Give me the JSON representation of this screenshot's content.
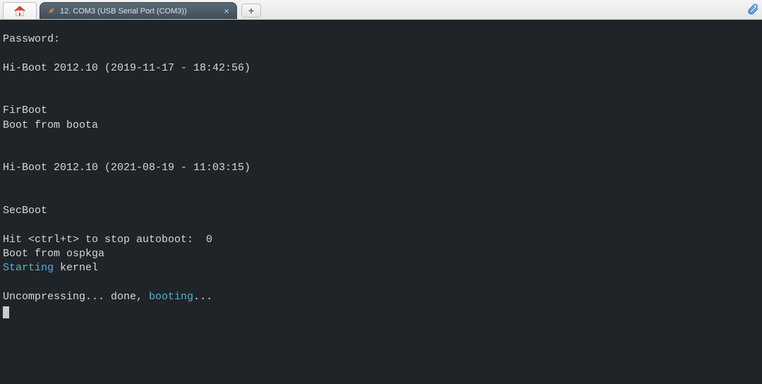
{
  "tabs": {
    "home_icon": "home-icon",
    "session": {
      "label": "12. COM3 (USB Serial Port (COM3))",
      "icon": "rocket-icon"
    },
    "add_label": "+",
    "close_label": "×"
  },
  "terminal": {
    "lines": [
      {
        "segments": [
          {
            "t": "Password:",
            "c": ""
          }
        ]
      },
      {
        "segments": []
      },
      {
        "segments": [
          {
            "t": "Hi-Boot 2012.10 (2019-11-17 - 18:42:56)",
            "c": ""
          }
        ]
      },
      {
        "segments": []
      },
      {
        "segments": []
      },
      {
        "segments": [
          {
            "t": "FirBoot",
            "c": ""
          }
        ]
      },
      {
        "segments": [
          {
            "t": "Boot from boota",
            "c": ""
          }
        ]
      },
      {
        "segments": []
      },
      {
        "segments": []
      },
      {
        "segments": [
          {
            "t": "Hi-Boot 2012.10 (2021-08-19 - 11:03:15)",
            "c": ""
          }
        ]
      },
      {
        "segments": []
      },
      {
        "segments": []
      },
      {
        "segments": [
          {
            "t": "SecBoot",
            "c": ""
          }
        ]
      },
      {
        "segments": []
      },
      {
        "segments": [
          {
            "t": "Hit <ctrl+t> to stop autoboot:  0",
            "c": ""
          }
        ]
      },
      {
        "segments": [
          {
            "t": "Boot from ospkga",
            "c": ""
          }
        ]
      },
      {
        "segments": [
          {
            "t": "Starting",
            "c": "hl"
          },
          {
            "t": " kernel",
            "c": ""
          }
        ]
      },
      {
        "segments": []
      },
      {
        "segments": [
          {
            "t": "Uncompressing... done, ",
            "c": ""
          },
          {
            "t": "booting",
            "c": "hl"
          },
          {
            "t": "...",
            "c": ""
          }
        ]
      }
    ]
  }
}
